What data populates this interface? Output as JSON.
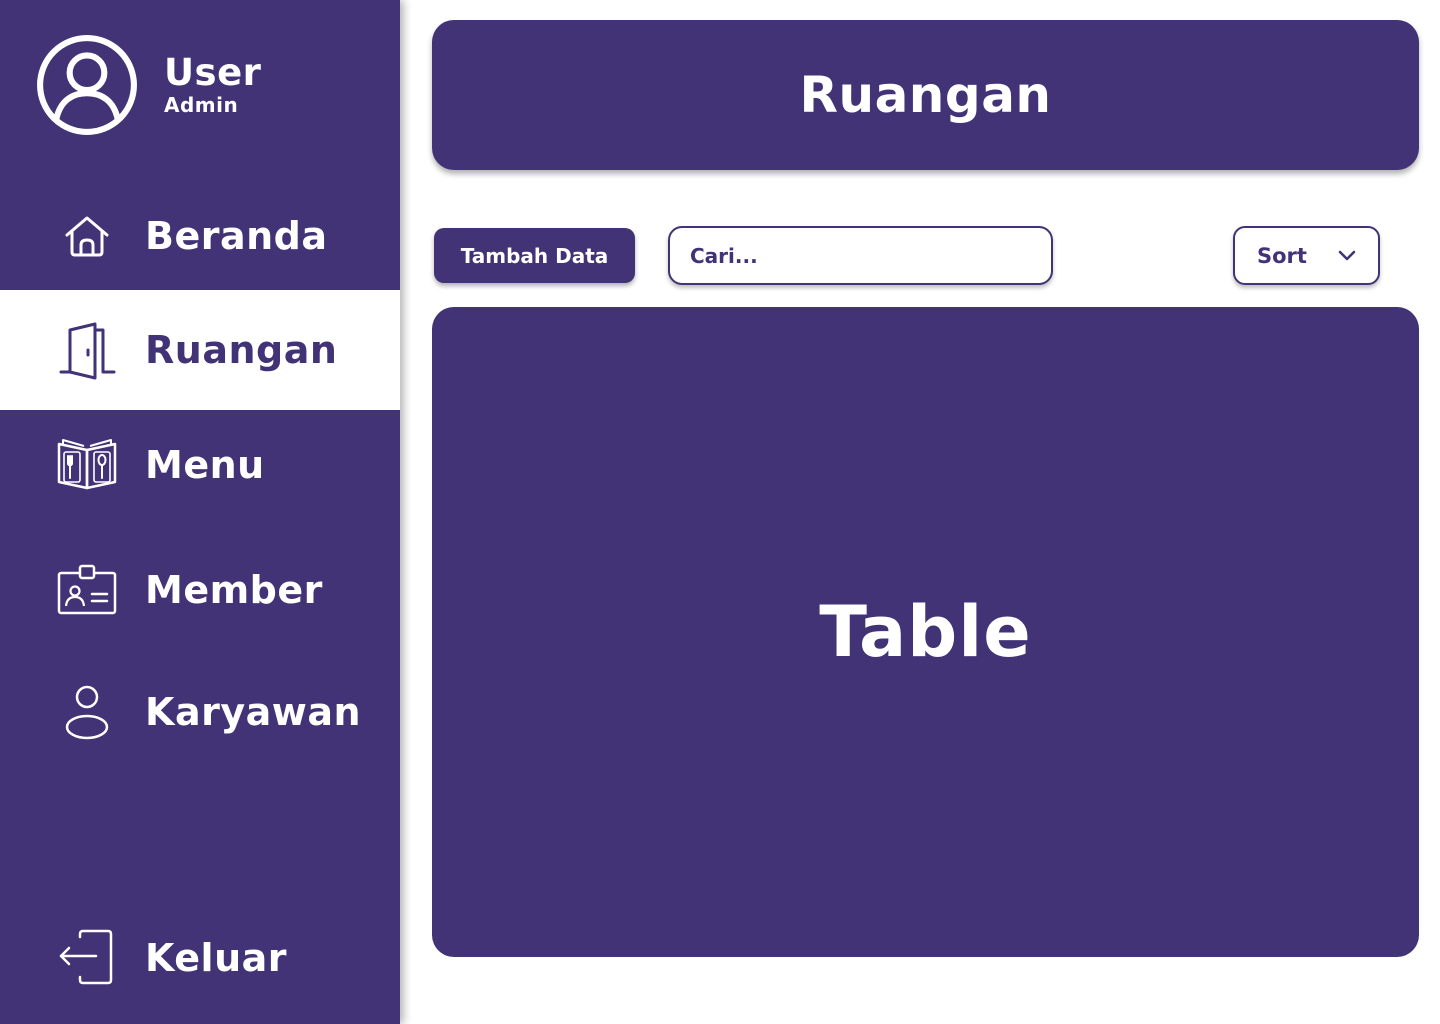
{
  "colors": {
    "primary": "#423276",
    "background": "#ffffff",
    "text_on_primary": "#ffffff"
  },
  "user": {
    "name": "User",
    "role": "Admin",
    "icon": "user-circle-icon"
  },
  "sidebar": {
    "items": [
      {
        "label": "Beranda",
        "icon": "home-icon",
        "active": false
      },
      {
        "label": "Ruangan",
        "icon": "door-icon",
        "active": true
      },
      {
        "label": "Menu",
        "icon": "menu-book-icon",
        "active": false
      },
      {
        "label": "Member",
        "icon": "id-card-icon",
        "active": false
      },
      {
        "label": "Karyawan",
        "icon": "person-icon",
        "active": false
      }
    ],
    "logout": {
      "label": "Keluar",
      "icon": "logout-icon"
    }
  },
  "header": {
    "title": "Ruangan"
  },
  "toolbar": {
    "add_label": "Tambah Data",
    "search_placeholder": "Cari...",
    "search_value": "",
    "sort_label": "Sort",
    "sort_icon": "chevron-down-icon"
  },
  "table": {
    "placeholder": "Table"
  }
}
